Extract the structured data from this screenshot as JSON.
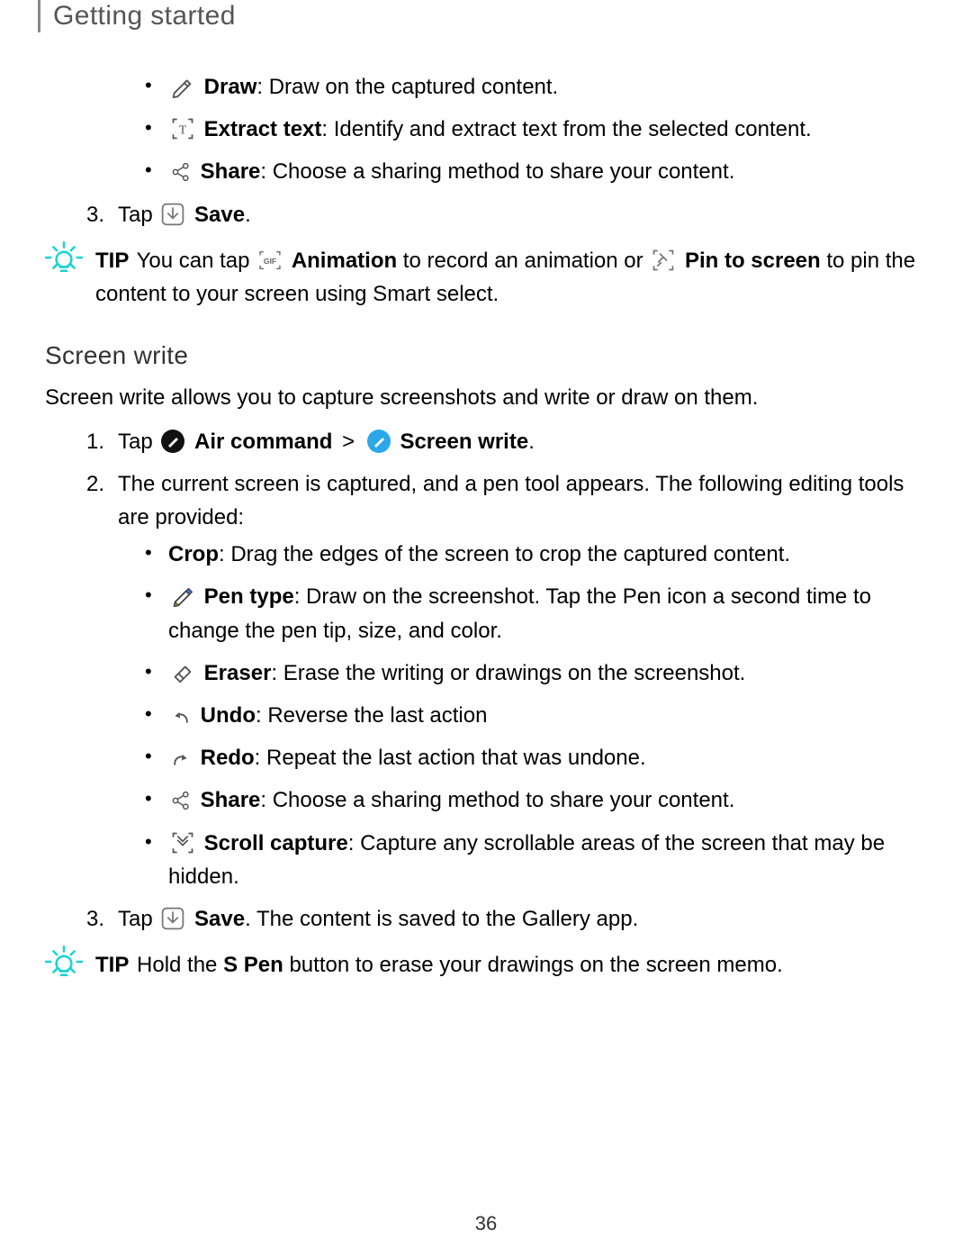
{
  "header": "Getting started",
  "page_number": "36",
  "first_list": {
    "sub_items": [
      {
        "bold": "Draw",
        "rest": ": Draw on the captured content."
      },
      {
        "bold": "Extract text",
        "rest": ": Identify and extract text from the selected content."
      },
      {
        "bold": "Share",
        "rest": ": Choose a sharing method to share your content."
      }
    ],
    "step3": {
      "num": "3.",
      "tap": "Tap ",
      "bold": "Save",
      "rest": "."
    }
  },
  "tip1": {
    "label": "TIP",
    "pt1": "  You can tap ",
    "animation_bold": "Animation",
    "pt2": " to record an animation or ",
    "pin_bold": "Pin to screen",
    "pt3": " to pin the content to your screen using Smart select."
  },
  "screen_write": {
    "heading": "Screen write",
    "intro": "Screen write allows you to capture screenshots and write or draw on them.",
    "step1": {
      "num": "1.",
      "tap": "Tap ",
      "air_bold": "Air command",
      "angle": ">",
      "sw_bold": "Screen write",
      "rest": "."
    },
    "step2": {
      "num": "2.",
      "text": "The current screen is captured, and a pen tool appears. The following editing tools are provided:"
    },
    "sub_items": [
      {
        "bold": "Crop",
        "rest": ": Drag the edges of the screen to crop the captured content.",
        "icon": null
      },
      {
        "bold": "Pen type",
        "rest": ": Draw on the screenshot. Tap the Pen icon a second time to change the pen tip, size, and color.",
        "icon": "pen-type"
      },
      {
        "bold": "Eraser",
        "rest": ": Erase the writing or drawings on the screenshot.",
        "icon": "eraser"
      },
      {
        "bold": "Undo",
        "rest": ": Reverse the last action",
        "icon": "undo"
      },
      {
        "bold": "Redo",
        "rest": ": Repeat the last action that was undone.",
        "icon": "redo"
      },
      {
        "bold": "Share",
        "rest": ": Choose a sharing method to share your content.",
        "icon": "share"
      },
      {
        "bold": "Scroll capture",
        "rest": ": Capture any scrollable areas of the screen that may be hidden.",
        "icon": "scroll"
      }
    ],
    "step3": {
      "num": "3.",
      "tap": "Tap ",
      "bold": "Save",
      "rest": ". The content is saved to the Gallery app."
    }
  },
  "tip2": {
    "label": "TIP",
    "pt1": "  Hold the ",
    "spen_bold": "S Pen",
    "pt2": " button to erase your drawings on the screen memo."
  }
}
